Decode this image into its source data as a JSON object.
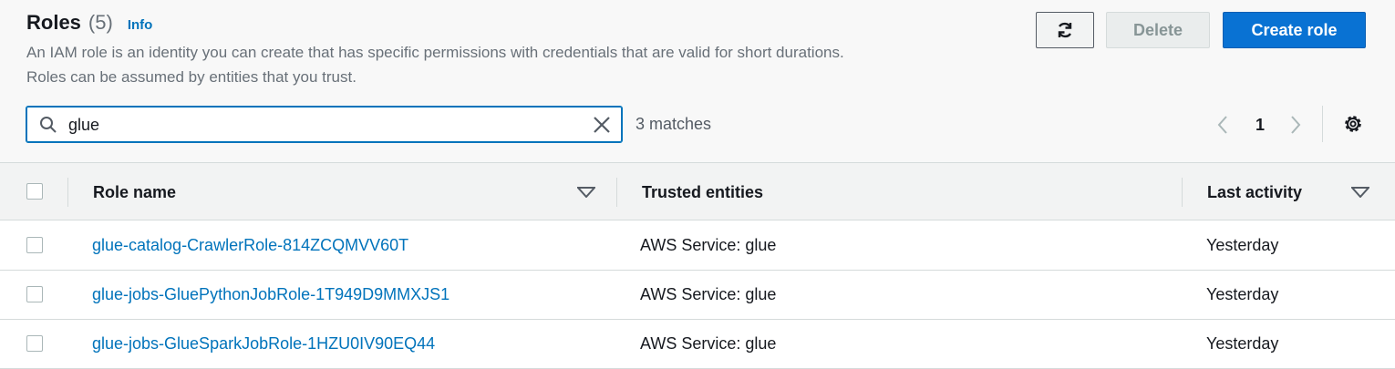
{
  "header": {
    "title": "Roles",
    "count": "(5)",
    "info": "Info",
    "description": "An IAM role is an identity you can create that has specific permissions with credentials that are valid for short durations. Roles can be assumed by entities that you trust."
  },
  "toolbar": {
    "refresh_icon": "refresh-icon",
    "delete_label": "Delete",
    "create_label": "Create role"
  },
  "search": {
    "value": "glue",
    "placeholder": "",
    "matches": "3 matches"
  },
  "pagination": {
    "page": "1"
  },
  "table": {
    "columns": [
      "Role name",
      "Trusted entities",
      "Last activity"
    ],
    "rows": [
      {
        "role_name": "glue-catalog-CrawlerRole-814ZCQMVV60T",
        "trusted": "AWS Service: glue",
        "last_activity": "Yesterday"
      },
      {
        "role_name": "glue-jobs-GluePythonJobRole-1T949D9MMXJS1",
        "trusted": "AWS Service: glue",
        "last_activity": "Yesterday"
      },
      {
        "role_name": "glue-jobs-GlueSparkJobRole-1HZU0IV90EQ44",
        "trusted": "AWS Service: glue",
        "last_activity": "Yesterday"
      }
    ]
  },
  "colors": {
    "primary": "#0972d3",
    "link": "#0073bb",
    "text": "#16191f",
    "muted": "#687078"
  }
}
